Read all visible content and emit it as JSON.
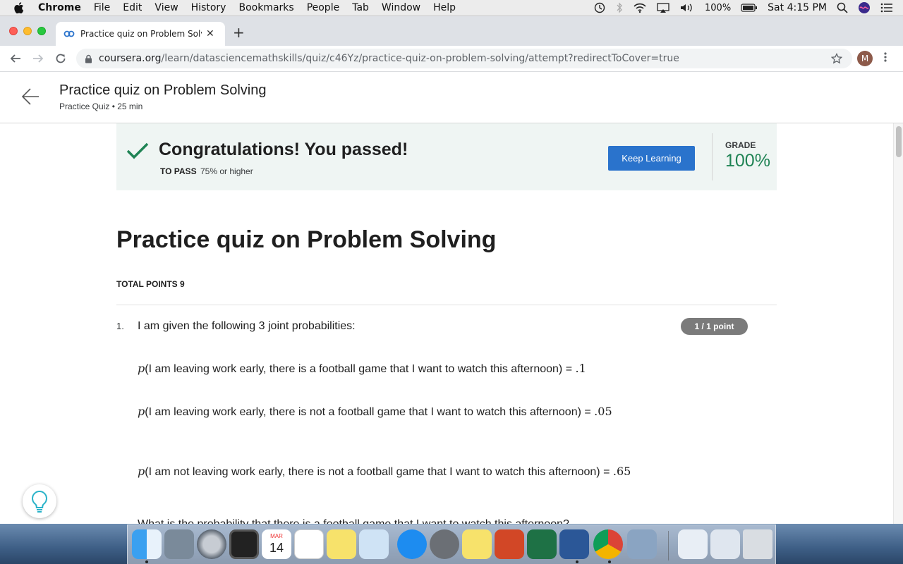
{
  "menubar": {
    "app": "Chrome",
    "items": [
      "File",
      "Edit",
      "View",
      "History",
      "Bookmarks",
      "People",
      "Tab",
      "Window",
      "Help"
    ],
    "battery": "100%",
    "clock": "Sat 4:15 PM"
  },
  "browser": {
    "tab_title": "Practice quiz on Problem Solvi",
    "url_host": "coursera.org",
    "url_path": "/learn/datasciencemathskills/quiz/c46Yz/practice-quiz-on-problem-solving/attempt?redirectToCover=true",
    "avatar_letter": "M"
  },
  "header": {
    "title": "Practice quiz on Problem Solving",
    "subtitle": "Practice Quiz • 25 min"
  },
  "banner": {
    "message": "Congratulations! You passed!",
    "to_pass_label": "TO PASS",
    "to_pass_value": "75% or higher",
    "button": "Keep Learning",
    "grade_label": "GRADE",
    "grade_value": "100%"
  },
  "quiz": {
    "title": "Practice quiz on Problem Solving",
    "total_points": "TOTAL POINTS 9",
    "question": {
      "number": "1.",
      "text": "I am given the following 3 joint probabilities:",
      "points": "1 / 1 point",
      "items": [
        {
          "p": "p",
          "text": "(I am leaving work early, there is a football game that I want to watch this afternoon) = ",
          "value": ".1"
        },
        {
          "p": "p",
          "text": "(I am leaving work early, there is not a football game that I want to watch this afternoon) = ",
          "value": ".05"
        },
        {
          "p": "p",
          "text": "(I am not leaving work early, there is not a football game that I want to watch this afternoon) = ",
          "value": ".65"
        }
      ],
      "next_line": "What is the probability that there is a football game that I want to watch this afternoon?"
    }
  },
  "colors": {
    "accent": "#2a73cc",
    "success": "#1f8354",
    "banner_bg": "#eff5f3",
    "badge": "#7b7b7b"
  },
  "icons": {
    "back": "arrow-left-icon",
    "check": "checkmark-icon",
    "hint": "lightbulb-icon"
  }
}
